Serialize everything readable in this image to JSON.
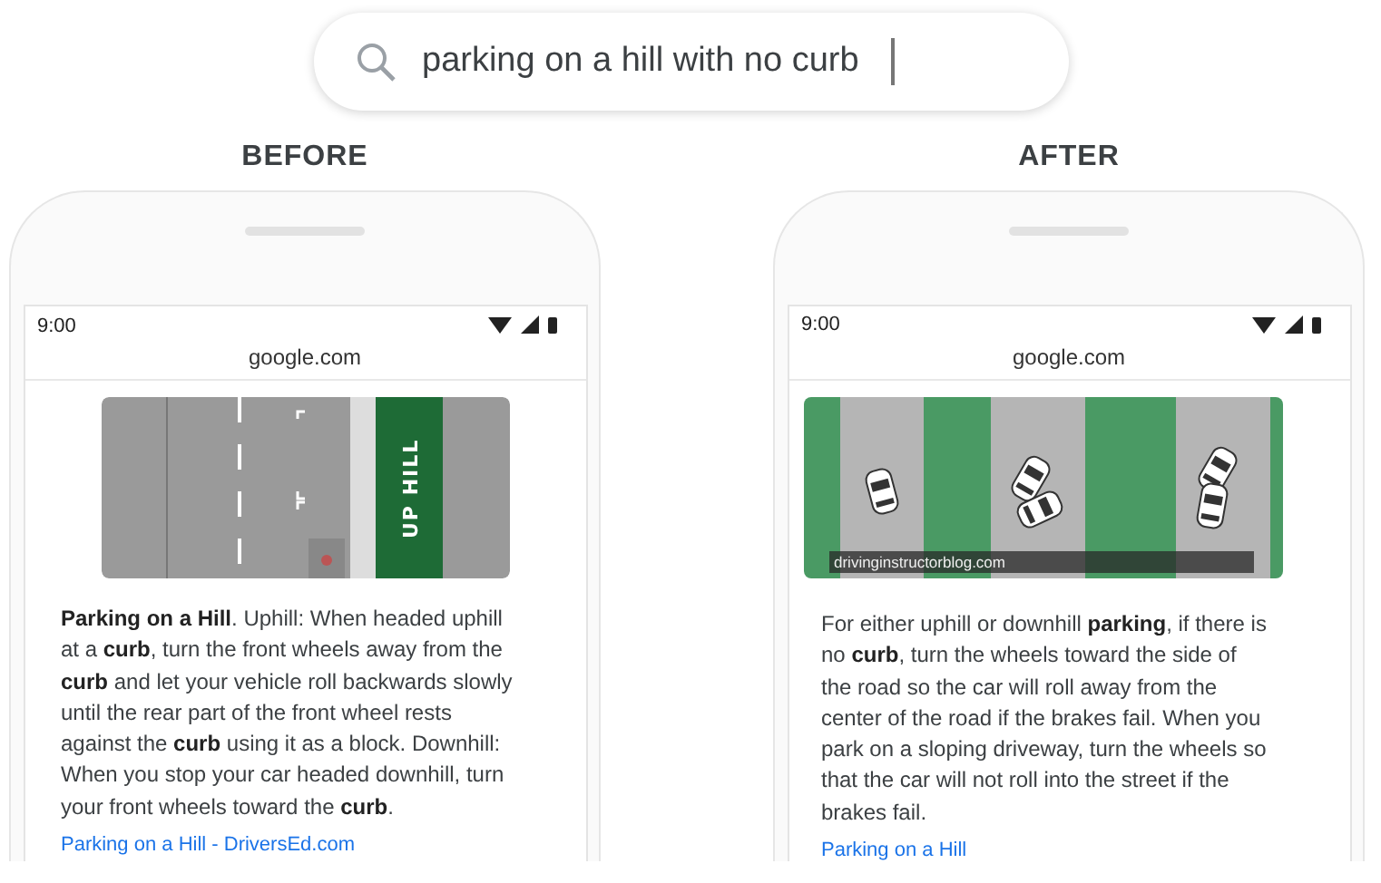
{
  "search": {
    "value": "parking on a hill with no curb"
  },
  "panels": [
    {
      "heading": "BEFORE",
      "time": "9:00",
      "url": "google.com",
      "image": {
        "kind": "road",
        "label": "UP HILL"
      },
      "snippet": "**Parking on a Hill**. Uphill: When headed uphill at a **curb**, turn the front wheels away from the **curb** and let your vehicle roll backwards slowly until the rear part of the front wheel rests against the **curb** using it as a block. Downhill: When you stop your car headed downhill, turn your front wheels toward the **curb**.",
      "link": "Parking on a Hill - DriversEd.com"
    },
    {
      "heading": "AFTER",
      "time": "9:00",
      "url": "google.com",
      "image": {
        "kind": "photo",
        "caption": "drivinginstructorblog.com"
      },
      "snippet": "For either uphill or downhill **parking**, if there is no **curb**, turn the wheels toward the side of the road so the car will roll away from the center of the road if the brakes fail. When you park on a sloping driveway, turn the wheels so that the car will not roll into the street if the brakes fail.",
      "link": "Parking on a Hill"
    }
  ]
}
